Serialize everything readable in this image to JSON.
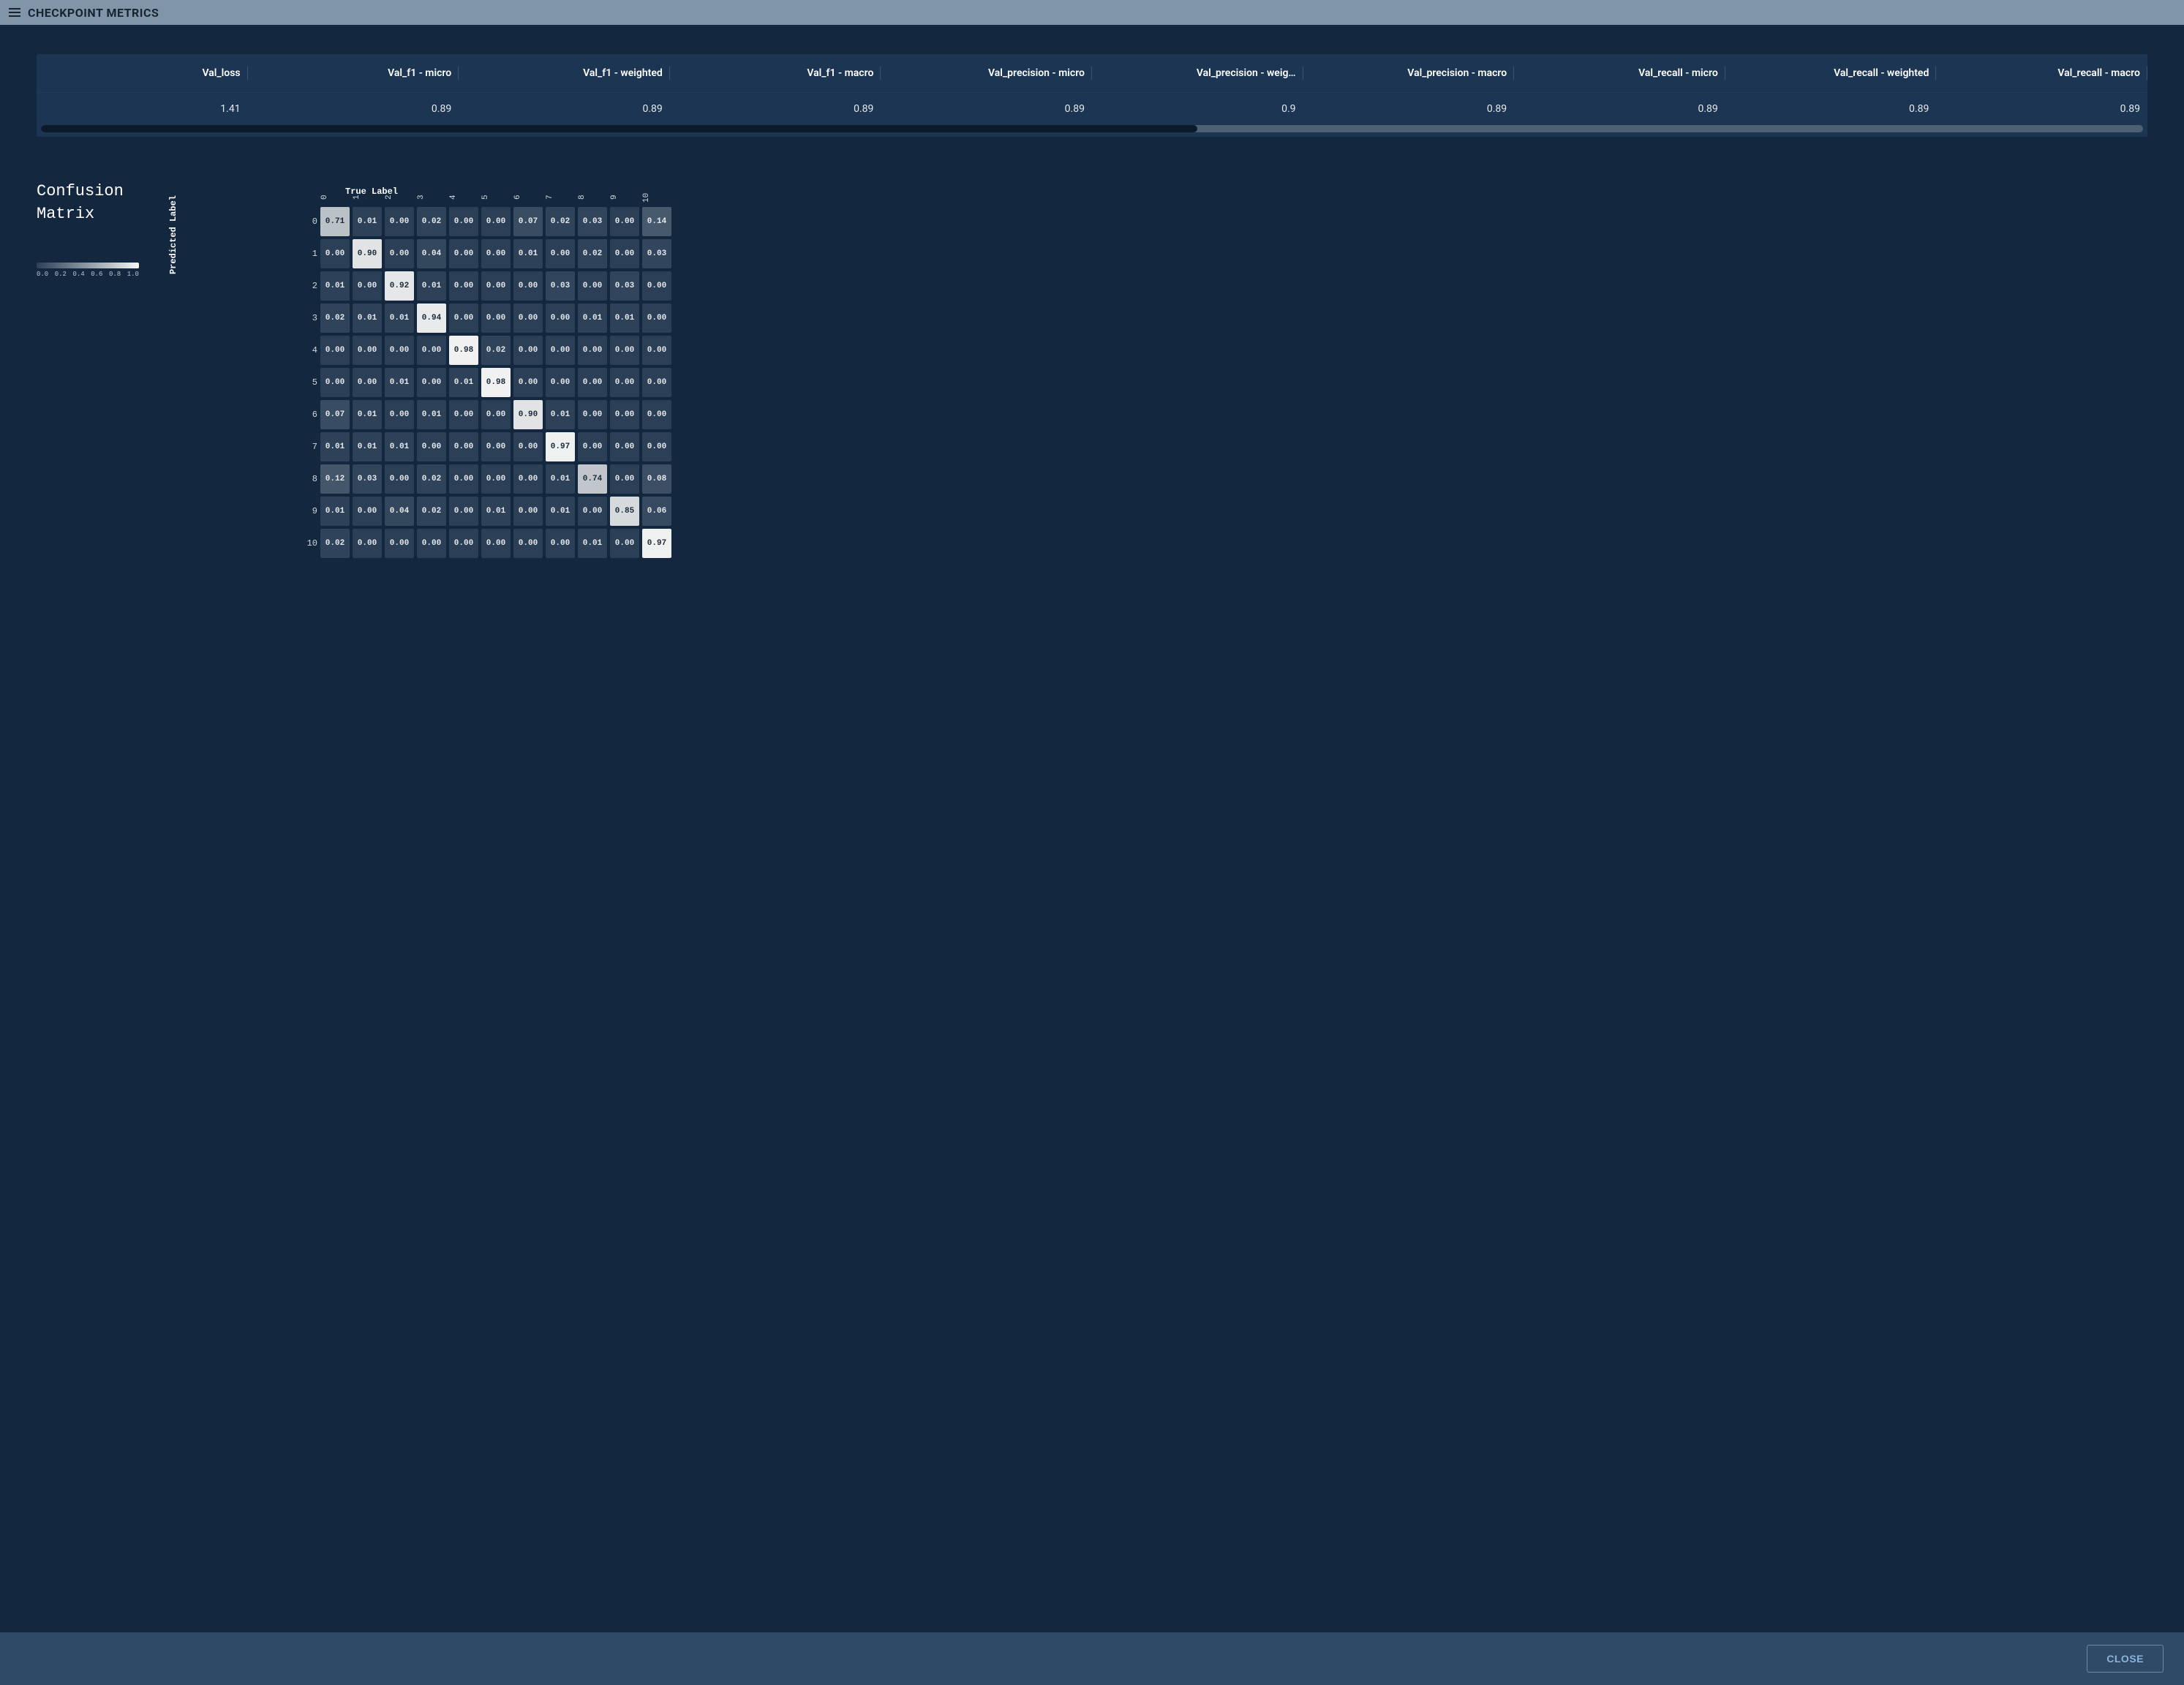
{
  "header": {
    "title": "CHECKPOINT METRICS"
  },
  "metrics": {
    "columns": [
      "Val_loss",
      "Val_f1 - micro",
      "Val_f1 - weighted",
      "Val_f1 - macro",
      "Val_precision - micro",
      "Val_precision - weig…",
      "Val_precision - macro",
      "Val_recall - micro",
      "Val_recall - weighted",
      "Val_recall - macro"
    ],
    "values": [
      "1.41",
      "0.89",
      "0.89",
      "0.89",
      "0.89",
      "0.9",
      "0.89",
      "0.89",
      "0.89",
      "0.89"
    ],
    "progress_pct": 55
  },
  "confusion_matrix": {
    "title_line1": "Confusion",
    "title_line2": "Matrix",
    "predicted_label": "Predicted Label",
    "true_label": "True Label",
    "scale_ticks": [
      "0.0",
      "0.2",
      "0.4",
      "0.6",
      "0.8",
      "1.0"
    ],
    "class_labels": [
      "0",
      "1",
      "2",
      "3",
      "4",
      "5",
      "6",
      "7",
      "8",
      "9",
      "10"
    ]
  },
  "chart_data": {
    "type": "heatmap",
    "title": "Confusion Matrix",
    "xlabel": "Predicted Label",
    "ylabel": "True Label",
    "x_categories": [
      "0",
      "1",
      "2",
      "3",
      "4",
      "5",
      "6",
      "7",
      "8",
      "9",
      "10"
    ],
    "y_categories": [
      "0",
      "1",
      "2",
      "3",
      "4",
      "5",
      "6",
      "7",
      "8",
      "9",
      "10"
    ],
    "range": [
      0.0,
      1.0
    ],
    "values": [
      [
        0.71,
        0.01,
        0.0,
        0.02,
        0.0,
        0.0,
        0.07,
        0.02,
        0.03,
        0.0,
        0.14
      ],
      [
        0.0,
        0.9,
        0.0,
        0.04,
        0.0,
        0.0,
        0.01,
        0.0,
        0.02,
        0.0,
        0.03
      ],
      [
        0.01,
        0.0,
        0.92,
        0.01,
        0.0,
        0.0,
        0.0,
        0.03,
        0.0,
        0.03,
        0.0
      ],
      [
        0.02,
        0.01,
        0.01,
        0.94,
        0.0,
        0.0,
        0.0,
        0.0,
        0.01,
        0.01,
        0.0
      ],
      [
        0.0,
        0.0,
        0.0,
        0.0,
        0.98,
        0.02,
        0.0,
        0.0,
        0.0,
        0.0,
        0.0
      ],
      [
        0.0,
        0.0,
        0.01,
        0.0,
        0.01,
        0.98,
        0.0,
        0.0,
        0.0,
        0.0,
        0.0
      ],
      [
        0.07,
        0.01,
        0.0,
        0.01,
        0.0,
        0.0,
        0.9,
        0.01,
        0.0,
        0.0,
        0.0
      ],
      [
        0.01,
        0.01,
        0.01,
        0.0,
        0.0,
        0.0,
        0.0,
        0.97,
        0.0,
        0.0,
        0.0
      ],
      [
        0.12,
        0.03,
        0.0,
        0.02,
        0.0,
        0.0,
        0.0,
        0.01,
        0.74,
        0.0,
        0.08
      ],
      [
        0.01,
        0.0,
        0.04,
        0.02,
        0.0,
        0.01,
        0.0,
        0.01,
        0.0,
        0.85,
        0.06
      ],
      [
        0.02,
        0.0,
        0.0,
        0.0,
        0.0,
        0.0,
        0.0,
        0.0,
        0.01,
        0.0,
        0.97
      ]
    ]
  },
  "footer": {
    "close_label": "CLOSE"
  }
}
